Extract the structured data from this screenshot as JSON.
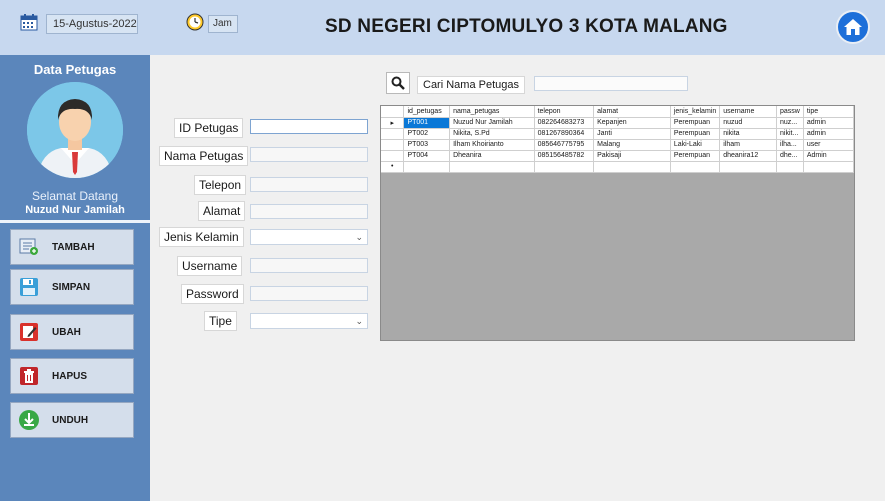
{
  "header": {
    "date": "15-Agustus-2022",
    "time_label": "Jam",
    "title": "SD NEGERI CIPTOMULYO 3 KOTA MALANG"
  },
  "sidebar": {
    "title": "Data Petugas",
    "welcome": "Selamat Datang",
    "user_name": "Nuzud Nur Jamilah",
    "buttons": [
      {
        "label": "TAMBAH",
        "icon": "add-form-icon"
      },
      {
        "label": "SIMPAN",
        "icon": "save-icon"
      },
      {
        "label": "UBAH",
        "icon": "edit-icon"
      },
      {
        "label": "HAPUS",
        "icon": "delete-icon"
      },
      {
        "label": "UNDUH",
        "icon": "download-icon"
      }
    ]
  },
  "form": {
    "id_petugas": "ID Petugas",
    "nama_petugas": "Nama Petugas",
    "telepon": "Telepon",
    "alamat": "Alamat",
    "jenis_kelamin": "Jenis Kelamin",
    "username": "Username",
    "password": "Password",
    "tipe": "Tipe"
  },
  "search": {
    "label": "Cari Nama Petugas"
  },
  "grid": {
    "columns": [
      "id_petugas",
      "nama_petugas",
      "telepon",
      "alamat",
      "jenis_kelamin",
      "username",
      "passw",
      "tipe"
    ],
    "rows": [
      [
        "PT001",
        "Nuzud Nur Jamilah",
        "082264683273",
        "Kepanjen",
        "Perempuan",
        "nuzud",
        "nuz...",
        "admin"
      ],
      [
        "PT002",
        "Nikita, S.Pd",
        "081267890364",
        "Janti",
        "Perempuan",
        "nikita",
        "nikit...",
        "admin"
      ],
      [
        "PT003",
        "Ilham Khoirianto",
        "085646775795",
        "Malang",
        "Laki-Laki",
        "ilham",
        "ilha...",
        "user"
      ],
      [
        "PT004",
        "Dheanira",
        "085156485782",
        "Pakisaji",
        "Perempuan",
        "dheanira12",
        "dhe...",
        "Admin"
      ]
    ]
  },
  "colors": {
    "sidebar": "#5b86bb",
    "header": "#c7d8ef",
    "selection": "#0a78d7"
  }
}
